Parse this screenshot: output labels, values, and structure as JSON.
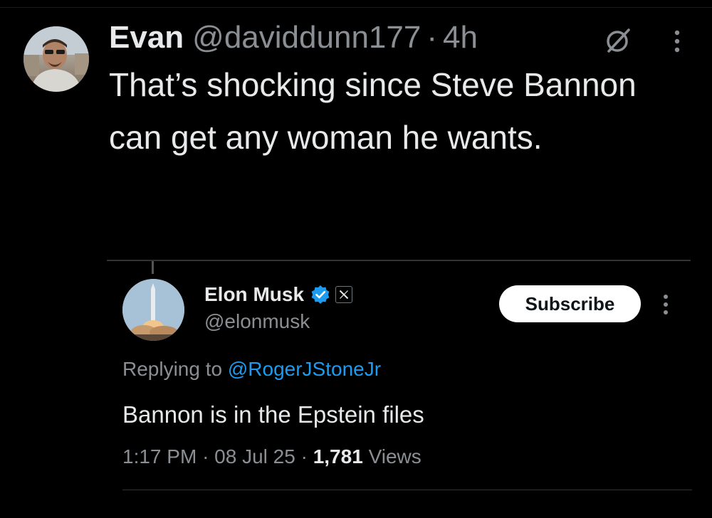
{
  "reply_tweet": {
    "author_name": "Evan",
    "author_handle": "@daviddunn177",
    "separator": "·",
    "time": "4h",
    "text": "That’s shocking since Steve Bannon can get any woman he wants.",
    "grok_icon": "grok-slash-circle-icon",
    "more_icon": "vertical-ellipsis-icon"
  },
  "quoted_tweet": {
    "author_name": "Elon Musk",
    "author_handle": "@elonmusk",
    "verified_icon": "verified-badge-icon",
    "affiliation_icon": "x-logo-icon",
    "subscribe_label": "Subscribe",
    "more_icon": "vertical-ellipsis-icon",
    "replying_prefix": "Replying to ",
    "replying_to": "@RogerJStoneJr",
    "text": "Bannon is in the Epstein files",
    "time": "1:17 PM",
    "date": "08 Jul 25",
    "separator": "·",
    "views_count": "1,781",
    "views_label": "Views"
  },
  "colors": {
    "background": "#000000",
    "text_primary": "#e7e9ea",
    "text_secondary": "#8b8f94",
    "link": "#1d9bf0",
    "verified": "#1d9bf0",
    "subscribe_bg": "#ffffff"
  }
}
